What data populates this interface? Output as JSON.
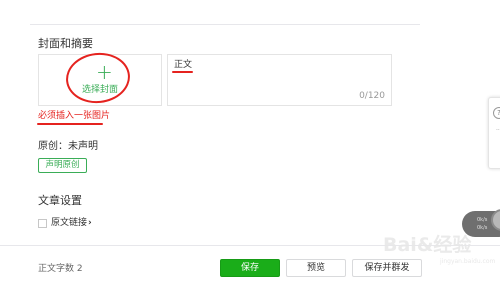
{
  "cover_section": {
    "title": "封面和摘要",
    "cover_button_label": "选择封面",
    "plus_glyph": "+",
    "summary_text": "正文",
    "summary_count": "0/120",
    "error_message": "必须插入一张图片"
  },
  "original": {
    "title": "原创：未声明",
    "declare_button": "声明原创"
  },
  "article_settings": {
    "title": "文章设置",
    "original_link_label": "原文链接",
    "chevron": "›"
  },
  "footer": {
    "word_count": "正文字数 2",
    "save_button": "保存",
    "preview_button": "预览",
    "save_send_button": "保存并群发"
  },
  "side_panel": {
    "help_glyph": "?"
  },
  "floating_widget": {
    "line1": "0k/s",
    "line2": "0k/s"
  },
  "watermark": {
    "text": "Bai&经验",
    "sub": "jingyan.baidu.com"
  },
  "colors": {
    "accent_green": "#1aad19",
    "annotation_red": "#e5231f"
  }
}
